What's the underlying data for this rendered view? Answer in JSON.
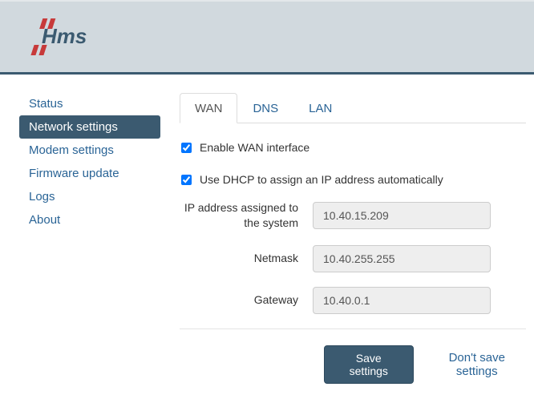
{
  "sidebar": {
    "items": [
      {
        "label": "Status"
      },
      {
        "label": "Network settings"
      },
      {
        "label": "Modem settings"
      },
      {
        "label": "Firmware update"
      },
      {
        "label": "Logs"
      },
      {
        "label": "About"
      }
    ],
    "active_index": 1
  },
  "tabs": {
    "items": [
      {
        "label": "WAN"
      },
      {
        "label": "DNS"
      },
      {
        "label": "LAN"
      }
    ],
    "active_index": 0
  },
  "form": {
    "enable_wan_label": "Enable WAN interface",
    "enable_wan_checked": true,
    "use_dhcp_label": "Use DHCP to assign an IP address automatically",
    "use_dhcp_checked": true,
    "ip_label": "IP address assigned to the system",
    "ip_value": "10.40.15.209",
    "netmask_label": "Netmask",
    "netmask_value": "10.40.255.255",
    "gateway_label": "Gateway",
    "gateway_value": "10.40.0.1"
  },
  "actions": {
    "save_label": "Save settings",
    "dont_save_label": "Don't save settings"
  },
  "brand": {
    "name": "Hms",
    "accent_color": "#c73a3a",
    "text_color": "#3b5a70"
  }
}
